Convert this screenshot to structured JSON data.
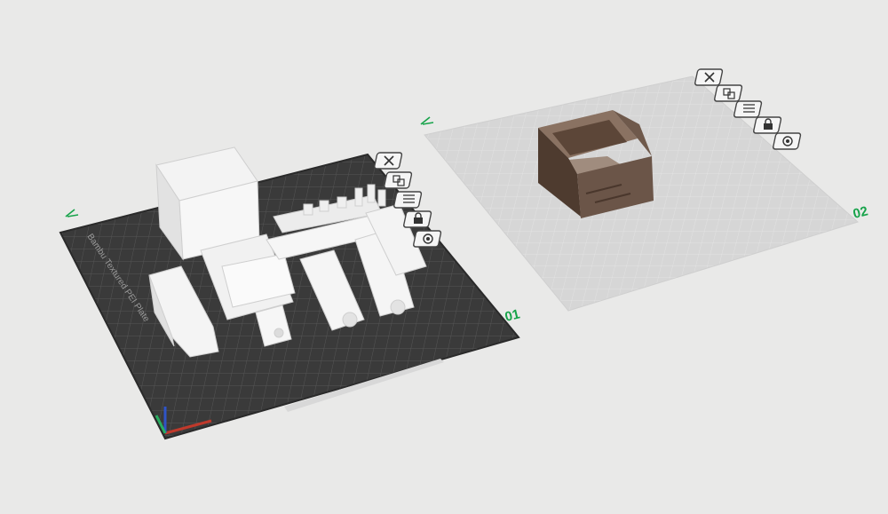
{
  "plates": [
    {
      "label": "01",
      "bed_text": "Bambu Textured PEI Plate",
      "tools": [
        {
          "name": "delete-plate-icon"
        },
        {
          "name": "arrange-plate-icon"
        },
        {
          "name": "slice-plate-icon"
        },
        {
          "name": "lock-plate-icon"
        },
        {
          "name": "plate-settings-icon"
        }
      ]
    },
    {
      "label": "02",
      "tools": [
        {
          "name": "delete-plate-icon"
        },
        {
          "name": "arrange-plate-icon"
        },
        {
          "name": "slice-plate-icon"
        },
        {
          "name": "lock-plate-icon"
        },
        {
          "name": "plate-settings-icon"
        }
      ]
    }
  ],
  "colors": {
    "background": "#e9e9e8",
    "plate1_bed": "#3a3a3a",
    "plate2_bed": "#d6d6d6",
    "model_white": "#f2f2f2",
    "model_brown": "#6b5548",
    "accent_green": "#17a34a"
  }
}
